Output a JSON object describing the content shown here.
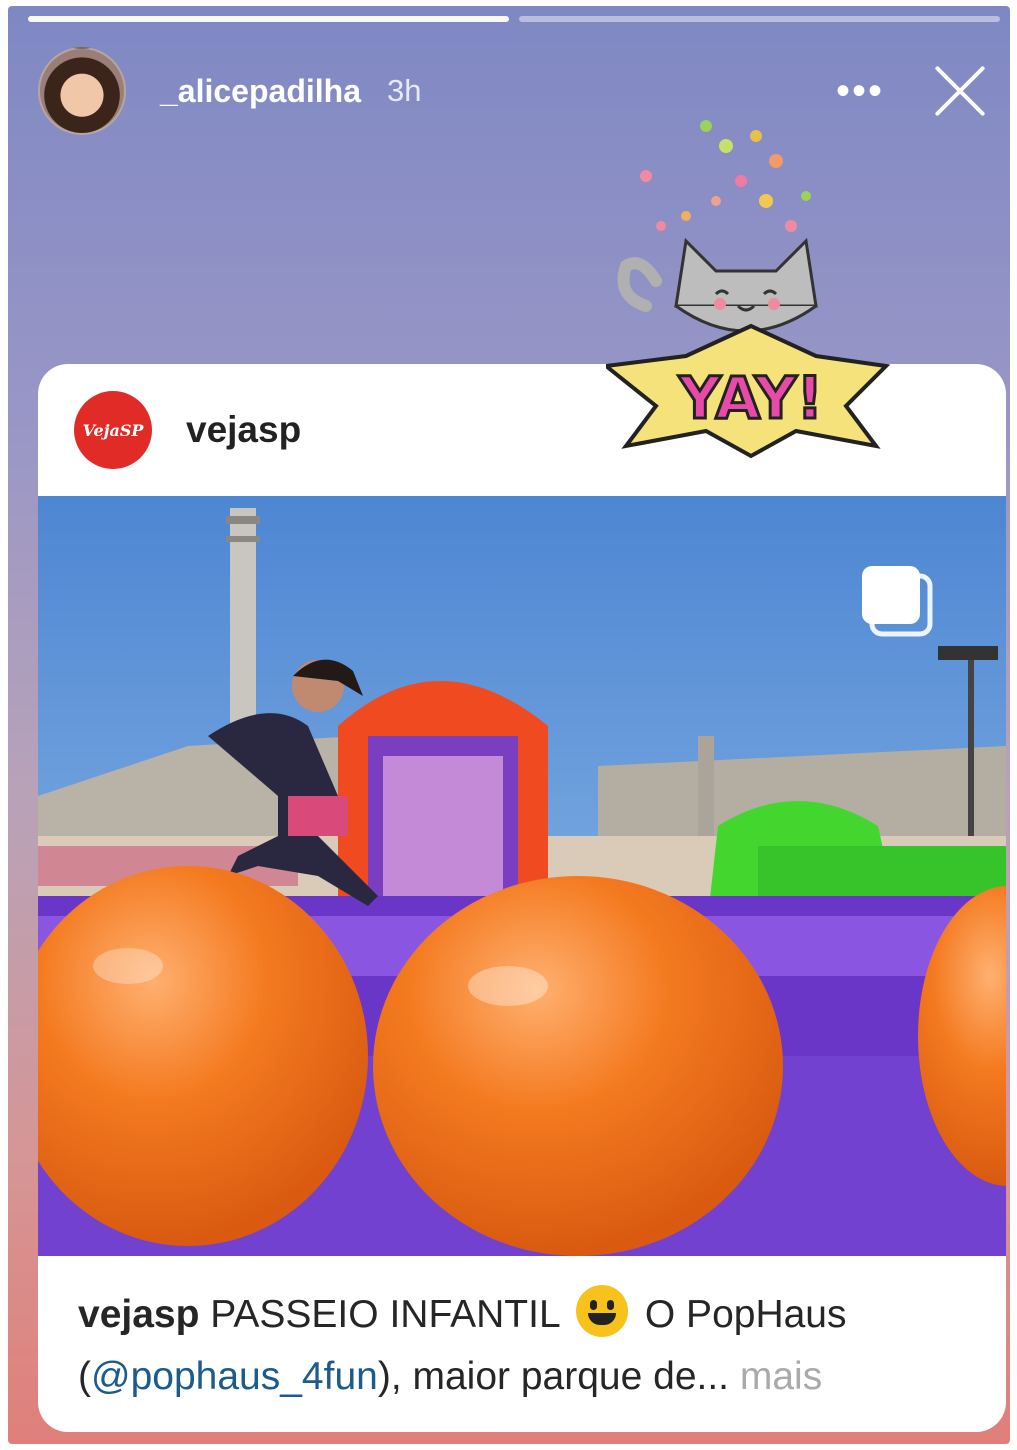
{
  "story": {
    "username": "_alicepadilha",
    "time": "3h",
    "progress_segments": 2,
    "progress_current": 1
  },
  "header": {
    "more_icon": "more-horizontal-icon",
    "close_icon": "close-icon"
  },
  "sticker": {
    "text": "YAY!",
    "icon": "cat-yay-sticker"
  },
  "post": {
    "username": "vejasp",
    "logo_text": "VejaSP",
    "multi_icon": "carousel-icon",
    "caption": {
      "user": "vejasp",
      "text1": "PASSEIO INFANTIL",
      "emoji": "smiley-emoji",
      "text2": "O PopHaus",
      "mention": "@pophaus_4fun",
      "paren_open": "(",
      "paren_close": ")",
      "text3": ", maior parque de...",
      "more": "mais"
    }
  },
  "colors": {
    "gradient_top": "#7f88c4",
    "gradient_bottom": "#e07f7a",
    "sky": "#5d93d6",
    "inflatable_orange": "#f07a1e",
    "inflatable_purple": "#7b44c9",
    "logo_red": "#e02b27"
  }
}
